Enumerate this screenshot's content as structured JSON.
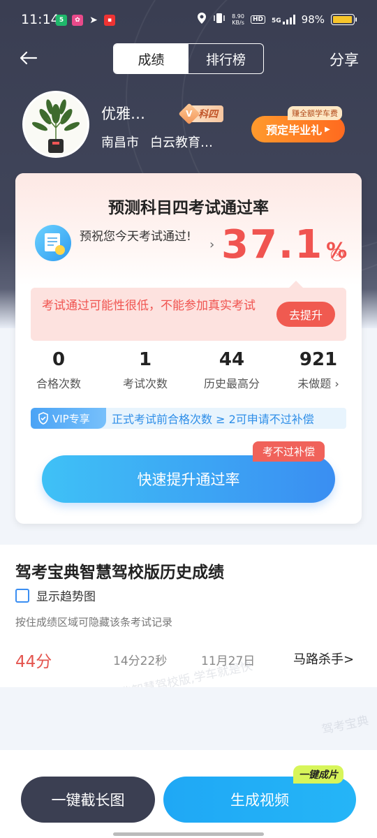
{
  "status_bar": {
    "time": "11:14",
    "net_speed_value": "8.90",
    "net_speed_unit": "KB/s",
    "hd": "HD",
    "network": "5G",
    "battery": "98%",
    "battery_level": 0.98
  },
  "header": {
    "tabs": [
      {
        "label": "成绩",
        "active": true
      },
      {
        "label": "排行榜",
        "active": false
      }
    ],
    "share": "分享"
  },
  "profile": {
    "name": "优雅…",
    "subject_v": "V",
    "subject": "科四",
    "city": "南昌市",
    "school": "白云教育…",
    "gift_tag": "赚全额学车费",
    "gift_button": "预定毕业礼"
  },
  "card": {
    "title": "预测科目四考试通过率",
    "wish": "预祝您今天考试通过!",
    "pass_rate": "37.1",
    "pass_rate_unit": "%",
    "warning": "考试通过可能性很低，不能参加真实考试",
    "improve_button": "去提升",
    "stats": [
      {
        "value": "0",
        "label": "合格次数"
      },
      {
        "value": "1",
        "label": "考试次数"
      },
      {
        "value": "44",
        "label": "历史最高分"
      },
      {
        "value": "921",
        "label": "未做题 ›"
      }
    ],
    "vip_tag": "VIP专享",
    "vip_text": "正式考试前合格次数 ≥ 2可申请不过补偿",
    "compensation_tag": "考不过补偿",
    "fast_button": "快速提升通过率"
  },
  "history": {
    "title": "驾考宝典智慧驾校版历史成绩",
    "show_trend": "显示趋势图",
    "hint": "按住成绩区域可隐藏该条考试记录",
    "records": [
      {
        "score": "44分",
        "duration": "14分22秒",
        "date": "11月27日",
        "title": "马路杀手>"
      }
    ],
    "watermark_1": "驾考宝典智慧驾校版,学车就是快",
    "watermark_2": "驾考宝典"
  },
  "bottom": {
    "long_screenshot": "一键截长图",
    "video_tag": "一键成片",
    "generate_video": "生成视频"
  },
  "colors": {
    "accent_red": "#f05450",
    "accent_blue": "#3a8ef2",
    "hero_dark": "#3a3e52"
  }
}
